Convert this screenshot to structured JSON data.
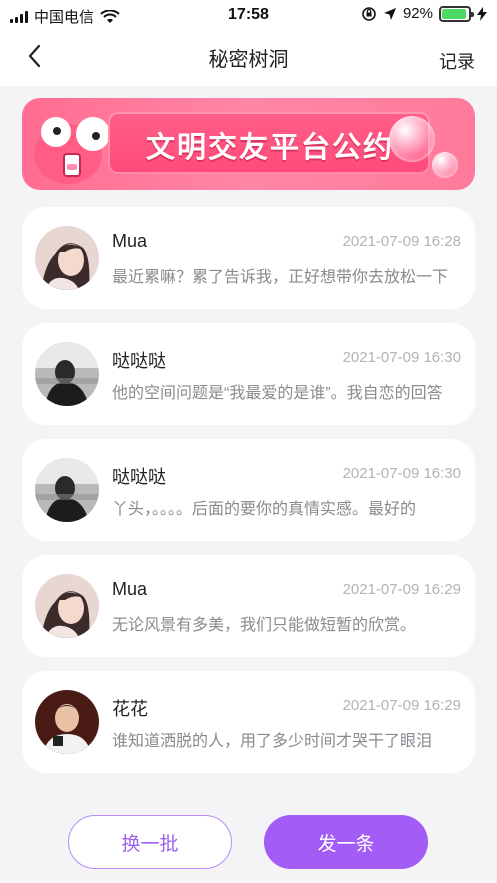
{
  "status_bar": {
    "carrier": "中国电信",
    "time": "17:58",
    "battery": "92%",
    "battery_level": 0.92,
    "icons": [
      "signal-icon",
      "wifi-icon",
      "rotation-lock-icon",
      "location-icon",
      "battery-icon",
      "charging-icon"
    ]
  },
  "nav": {
    "title": "秘密树洞",
    "record_label": "记录",
    "back_icon": "back-arrow-icon"
  },
  "banner": {
    "text": "文明交友平台公约"
  },
  "posts": [
    {
      "name": "Mua",
      "time": "2021-07-09 16:28",
      "message": "最近累嘛？累了告诉我，正好想带你去放松一下",
      "avatar": "girl"
    },
    {
      "name": "哒哒哒",
      "time": "2021-07-09 16:30",
      "message": "他的空间问题是“我最爱的是谁”。我自恋的回答",
      "avatar": "boy-dark"
    },
    {
      "name": "哒哒哒",
      "time": "2021-07-09 16:30",
      "message": "丫头，。。。。后面的要你的真情实感。最好的",
      "avatar": "boy-dark"
    },
    {
      "name": "Mua",
      "time": "2021-07-09 16:29",
      "message": "无论风景有多美，我们只能做短暂的欣赏。",
      "avatar": "girl"
    },
    {
      "name": "花花",
      "time": "2021-07-09 16:29",
      "message": "谁知道洒脱的人，用了多少时间才哭干了眼泪",
      "avatar": "man"
    }
  ],
  "buttons": {
    "change": "换一批",
    "post": "发一条"
  },
  "colors": {
    "accent": "#a35cf5",
    "banner_pink": "#ff6d91",
    "background": "#f4f4f6"
  }
}
